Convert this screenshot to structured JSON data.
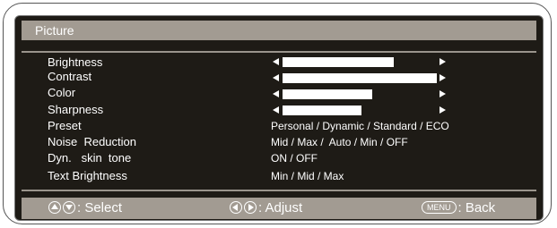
{
  "title": "Picture",
  "rows": [
    {
      "label": "Brightness",
      "level": 0.72
    },
    {
      "label": "Contrast",
      "level": 1.0
    },
    {
      "label": "Color",
      "level": 0.58
    },
    {
      "label": "Sharpness",
      "level": 0.51
    },
    {
      "label": "Preset",
      "value": "Personal / Dynamic / Standard / ECO"
    },
    {
      "label": "Noise  Reduction",
      "value": "Mid / Max /  Auto / Min / OFF"
    },
    {
      "label": "Dyn.   skin  tone",
      "value": "ON / OFF"
    },
    {
      "label": "Text Brightness",
      "value": "Min / Mid / Max"
    }
  ],
  "footer": {
    "select": ": Select",
    "adjust": ": Adjust",
    "menu_key": "MENU",
    "back": ": Back"
  },
  "icons": {
    "select": [
      "up-arrow-circle-icon",
      "down-arrow-circle-icon"
    ],
    "adjust": [
      "left-arrow-circle-icon",
      "right-arrow-circle-icon"
    ],
    "slider": [
      "left-arrow-icon",
      "right-arrow-icon"
    ]
  },
  "colors": {
    "background": "#1e1b16",
    "bar": "#a29b92",
    "text": "#ffffff"
  }
}
